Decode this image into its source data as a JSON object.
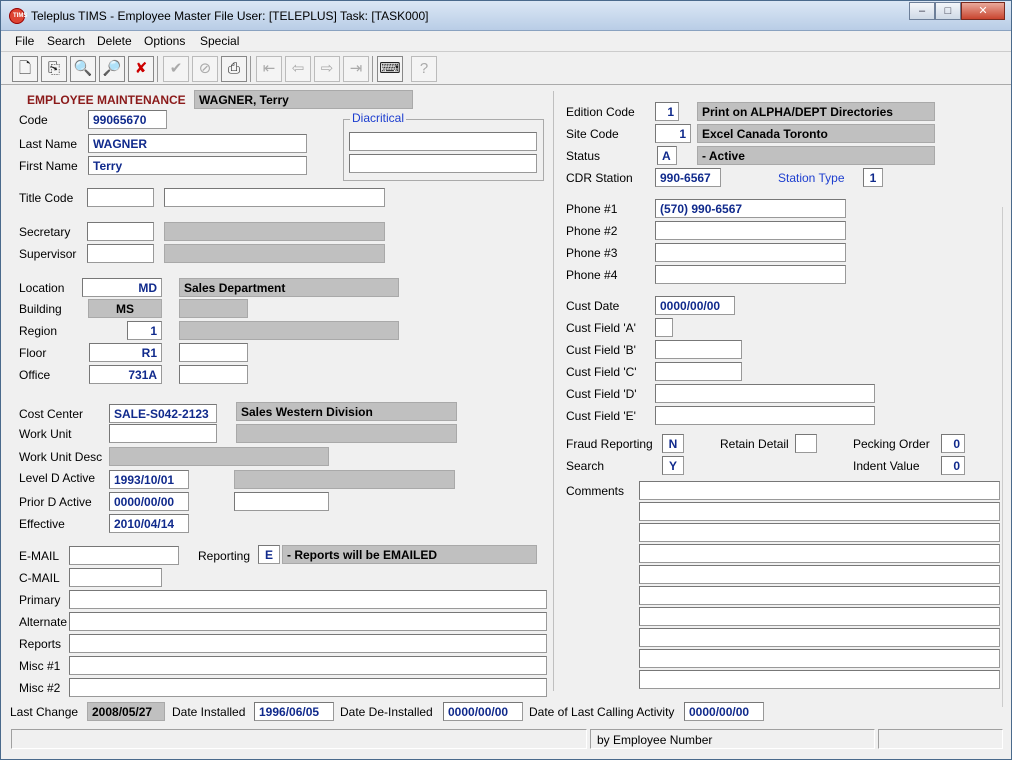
{
  "window": {
    "title": "Teleplus TIMS - Employee Master File  User: [TELEPLUS]  Task: [TASK000]",
    "app_icon": "tims-logo-icon",
    "controls": {
      "minimize": "–",
      "maximize": "□",
      "close": "✕"
    }
  },
  "menu": {
    "file": "File",
    "search": "Search",
    "delete": "Delete",
    "options": "Options",
    "special": "Special"
  },
  "toolbar": {
    "icons": [
      "new-icon",
      "copy-icon",
      "find-icon",
      "find-next-icon",
      "delete-x-icon",
      "confirm-check-icon",
      "cancel-icon",
      "print-icon",
      "first-record-icon",
      "prev-record-icon",
      "next-record-icon",
      "last-record-icon",
      "keyboard-icon",
      "help-icon"
    ]
  },
  "left": {
    "header_label": "EMPLOYEE MAINTENANCE",
    "header_name": "WAGNER, Terry",
    "code_label": "Code",
    "code": "99065670",
    "last_name_label": "Last Name",
    "last_name": "WAGNER",
    "first_name_label": "First Name",
    "first_name": "Terry",
    "diacritical_label": "Diacritical",
    "diacritical_1": "",
    "diacritical_2": "",
    "title_code_label": "Title Code",
    "title_code": "",
    "title_desc": "",
    "secretary_label": "Secretary",
    "secretary": "",
    "secretary_desc": "",
    "supervisor_label": "Supervisor",
    "supervisor": "",
    "supervisor_desc": "",
    "location_label": "Location",
    "location": "MD",
    "location_desc": "Sales Department",
    "building_label": "Building",
    "building": "MS",
    "building_desc": "",
    "region_label": "Region",
    "region": "1",
    "region_desc": "",
    "floor_label": "Floor",
    "floor": "R1",
    "floor_desc": "",
    "office_label": "Office",
    "office": "731A",
    "office_desc": "",
    "cost_center_label": "Cost Center",
    "cost_center": "SALE-S042-2123",
    "cost_center_desc": "Sales Western Division",
    "work_unit_label": "Work Unit",
    "work_unit": "",
    "work_unit_field2": "",
    "work_unit_desc_label": "Work Unit Desc",
    "work_unit_desc": "",
    "level_d_label": "Level D Active",
    "level_d": "1993/10/01",
    "level_d_desc": "",
    "prior_d_label": "Prior D Active",
    "prior_d": "0000/00/00",
    "prior_d_desc": "",
    "effective_label": "Effective",
    "effective": "2010/04/14",
    "email_label": "E-MAIL",
    "email": "",
    "reporting_label": "Reporting",
    "reporting": "E",
    "reporting_desc": "- Reports will be EMAILED",
    "cmail_label": "C-MAIL",
    "cmail": "",
    "primary_label": "Primary",
    "primary": "",
    "alternate_label": "Alternate",
    "alternate": "",
    "reports_label": "Reports",
    "reports": "",
    "misc1_label": "Misc #1",
    "misc1": "",
    "misc2_label": "Misc #2",
    "misc2": ""
  },
  "right": {
    "edition_label": "Edition Code",
    "edition": "1",
    "edition_desc": "Print on ALPHA/DEPT Directories",
    "site_label": "Site Code",
    "site": "1",
    "site_desc": "Excel Canada Toronto",
    "status_label": "Status",
    "status": "A",
    "status_desc": "- Active",
    "cdr_label": "CDR Station",
    "cdr": "990-6567",
    "station_type_label": "Station Type",
    "station_type": "1",
    "phone1_label": "Phone #1",
    "phone1": "(570) 990-6567",
    "phone2_label": "Phone #2",
    "phone2": "",
    "phone3_label": "Phone #3",
    "phone3": "",
    "phone4_label": "Phone #4",
    "phone4": "",
    "cust_date_label": "Cust Date",
    "cust_date": "0000/00/00",
    "cust_a_label": "Cust Field 'A'",
    "cust_a": "",
    "cust_b_label": "Cust Field 'B'",
    "cust_b": "",
    "cust_c_label": "Cust Field 'C'",
    "cust_c": "",
    "cust_d_label": "Cust Field 'D'",
    "cust_d": "",
    "cust_e_label": "Cust Field 'E'",
    "cust_e": "",
    "fraud_label": "Fraud Reporting",
    "fraud": "N",
    "retain_label": "Retain Detail",
    "retain": "",
    "pecking_label": "Pecking Order",
    "pecking": "0",
    "search_label": "Search",
    "search": "Y",
    "indent_label": "Indent Value",
    "indent": "0",
    "comments_label": "Comments",
    "comments": [
      "",
      "",
      "",
      "",
      "",
      "",
      "",
      "",
      "",
      ""
    ]
  },
  "bottom": {
    "last_change_label": "Last Change",
    "last_change": "2008/05/27",
    "installed_label": "Date Installed",
    "installed": "1996/06/05",
    "deinstalled_label": "Date De-Installed",
    "deinstalled": "0000/00/00",
    "last_call_label": "Date of Last Calling Activity",
    "last_call": "0000/00/00"
  },
  "status": {
    "pane1": "",
    "pane2": "by Employee Number",
    "pane3": ""
  }
}
